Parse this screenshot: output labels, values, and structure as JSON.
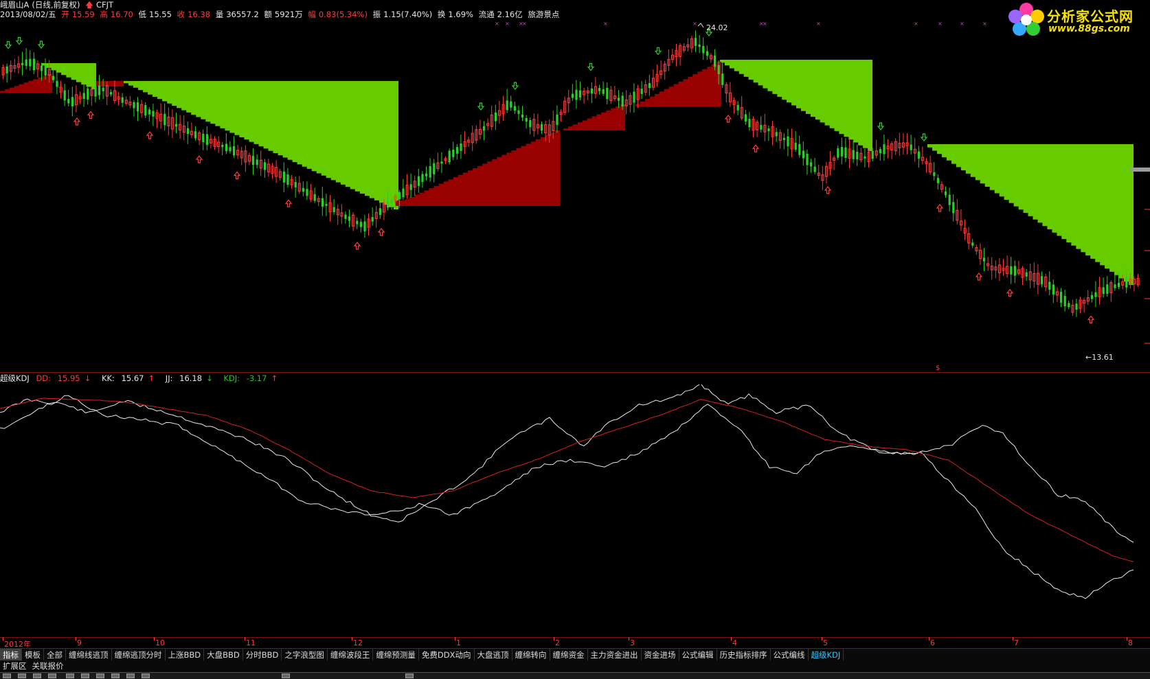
{
  "header": {
    "stock_name": "峨眉山A",
    "period": "(日线,前复权)",
    "indicator_tag": "CFJT",
    "date": "2013/08/02/五",
    "open_label": "开",
    "open": "15.59",
    "high_label": "高",
    "high": "16.70",
    "low_label": "低",
    "low": "15.55",
    "close_label": "收",
    "close": "16.38",
    "volume_label": "量",
    "volume": "36557.2",
    "amount_label": "额",
    "amount": "5921万",
    "change_label": "幅",
    "change": "0.83(5.34%)",
    "amplitude_label": "振",
    "amplitude": "1.15(7.40%)",
    "turnover_label": "换",
    "turnover": "1.69%",
    "float_label": "流通",
    "float": "2.16亿",
    "sector": "旅游景点"
  },
  "logo": {
    "title": "分析家公式网",
    "url": "www.88gs.com"
  },
  "main_chart": {
    "high_mark": "24.02",
    "low_mark": "←13.61",
    "extra_mark": "$"
  },
  "kdj": {
    "name": "超级KDJ",
    "dd_label": "DD:",
    "dd_value": "15.95",
    "kk_label": "KK:",
    "kk_value": "15.67",
    "jj_label": "JJ:",
    "jj_value": "16.18",
    "kdj_label": "KDJ:",
    "kdj_value": "-3.17"
  },
  "date_axis": [
    "2012年",
    "9",
    "10",
    "11",
    "12",
    "1",
    "2",
    "3",
    "4",
    "5",
    "6",
    "7",
    "8"
  ],
  "tabs": [
    "指标",
    "模板",
    "全部",
    "缠绵线逃顶",
    "缠绵逃顶分时",
    "上涨BBD",
    "大盘BBD",
    "分时BBD",
    "之字浪型图",
    "缠绵波段王",
    "缠绵预测量",
    "免费DDX动向",
    "大盘逃顶",
    "缠绵转向",
    "缠绵资金",
    "主力资金进出",
    "资金进场",
    "公式编辑",
    "历史指标排序",
    "公式编线",
    "超级KDJ"
  ],
  "ext_tabs": [
    "扩展区",
    "关联报价"
  ],
  "colors": {
    "up": "#ff3b3b",
    "down": "#28d128",
    "green_fill": "#66cc00",
    "red_fill": "#990000",
    "background": "#000000",
    "logo_yellow": "#f6e200",
    "selected_tab": "#27c7ff"
  }
}
